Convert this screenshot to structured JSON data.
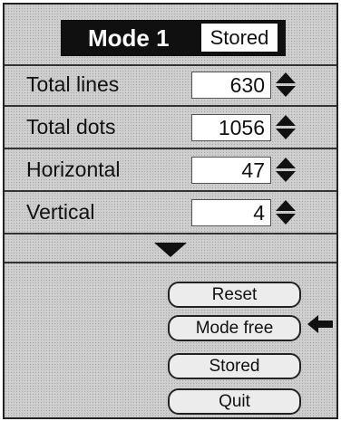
{
  "header": {
    "mode_label": "Mode 1",
    "status_label": "Stored"
  },
  "settings": [
    {
      "label": "Total lines",
      "value": "630"
    },
    {
      "label": "Total dots",
      "value": "1056"
    },
    {
      "label": "Horizontal",
      "value": "47"
    },
    {
      "label": "Vertical",
      "value": "4"
    }
  ],
  "buttons": {
    "reset": "Reset",
    "mode_free": "Mode free",
    "stored": "Stored",
    "quit": "Quit"
  },
  "icons": {
    "spinner": "up-down-arrows-icon",
    "more": "down-triangle-icon",
    "selection_pointer": "left-arrow-icon"
  },
  "colors": {
    "panel_background": "#cdcdcd",
    "header_bar": "#101010",
    "text": "#111111",
    "field_background": "#ffffff"
  }
}
